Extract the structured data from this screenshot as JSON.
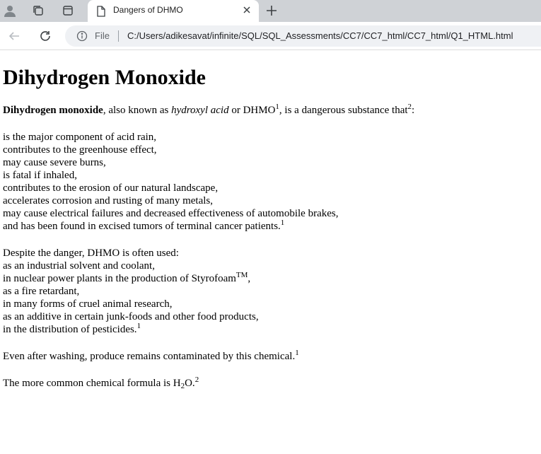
{
  "browser": {
    "tab_title": "Dangers of DHMO",
    "file_label": "File",
    "url": "C:/Users/adikesavat/infinite/SQL/SQL_Assessments/CC7/CC7_html/CC7_html/Q1_HTML.html"
  },
  "page": {
    "heading": "Dihydrogen Monoxide",
    "intro": {
      "bold_term": "Dihydrogen monoxide",
      "text_a": ", also known as ",
      "italic_term": "hydroxyl acid",
      "text_b": " or DHMO",
      "sup_a": "1",
      "text_c": ", is a dangerous substance that",
      "sup_b": "2",
      "text_d": ":"
    },
    "dangers": [
      "is the major component of acid rain,",
      "contributes to the greenhouse effect,",
      "may cause severe burns,",
      "is fatal if inhaled,",
      "contributes to the erosion of our natural landscape,",
      "accelerates corrosion and rusting of many metals,",
      "may cause electrical failures and decreased effectiveness of automobile brakes,"
    ],
    "dangers_last": {
      "text": "and has been found in excised tumors of terminal cancer patients.",
      "sup": "1"
    },
    "uses_intro": "Despite the danger, DHMO is often used:",
    "uses_a": "as an industrial solvent and coolant,",
    "uses_b": {
      "text": "in nuclear power plants in the production of Styrofoam",
      "sup": "TM",
      "after": ","
    },
    "uses_c": [
      "as a fire retardant,",
      "in many forms of cruel animal research,",
      "as an additive in certain junk-foods and other food products,"
    ],
    "uses_last": {
      "text": "in the distribution of pesticides.",
      "sup": "1"
    },
    "washing": {
      "text": "Even after washing, produce remains contaminated by this chemical.",
      "sup": "1"
    },
    "formula": {
      "text": "The more common chemical formula is H",
      "sub": "2",
      "after": "O.",
      "sup": "2"
    }
  }
}
